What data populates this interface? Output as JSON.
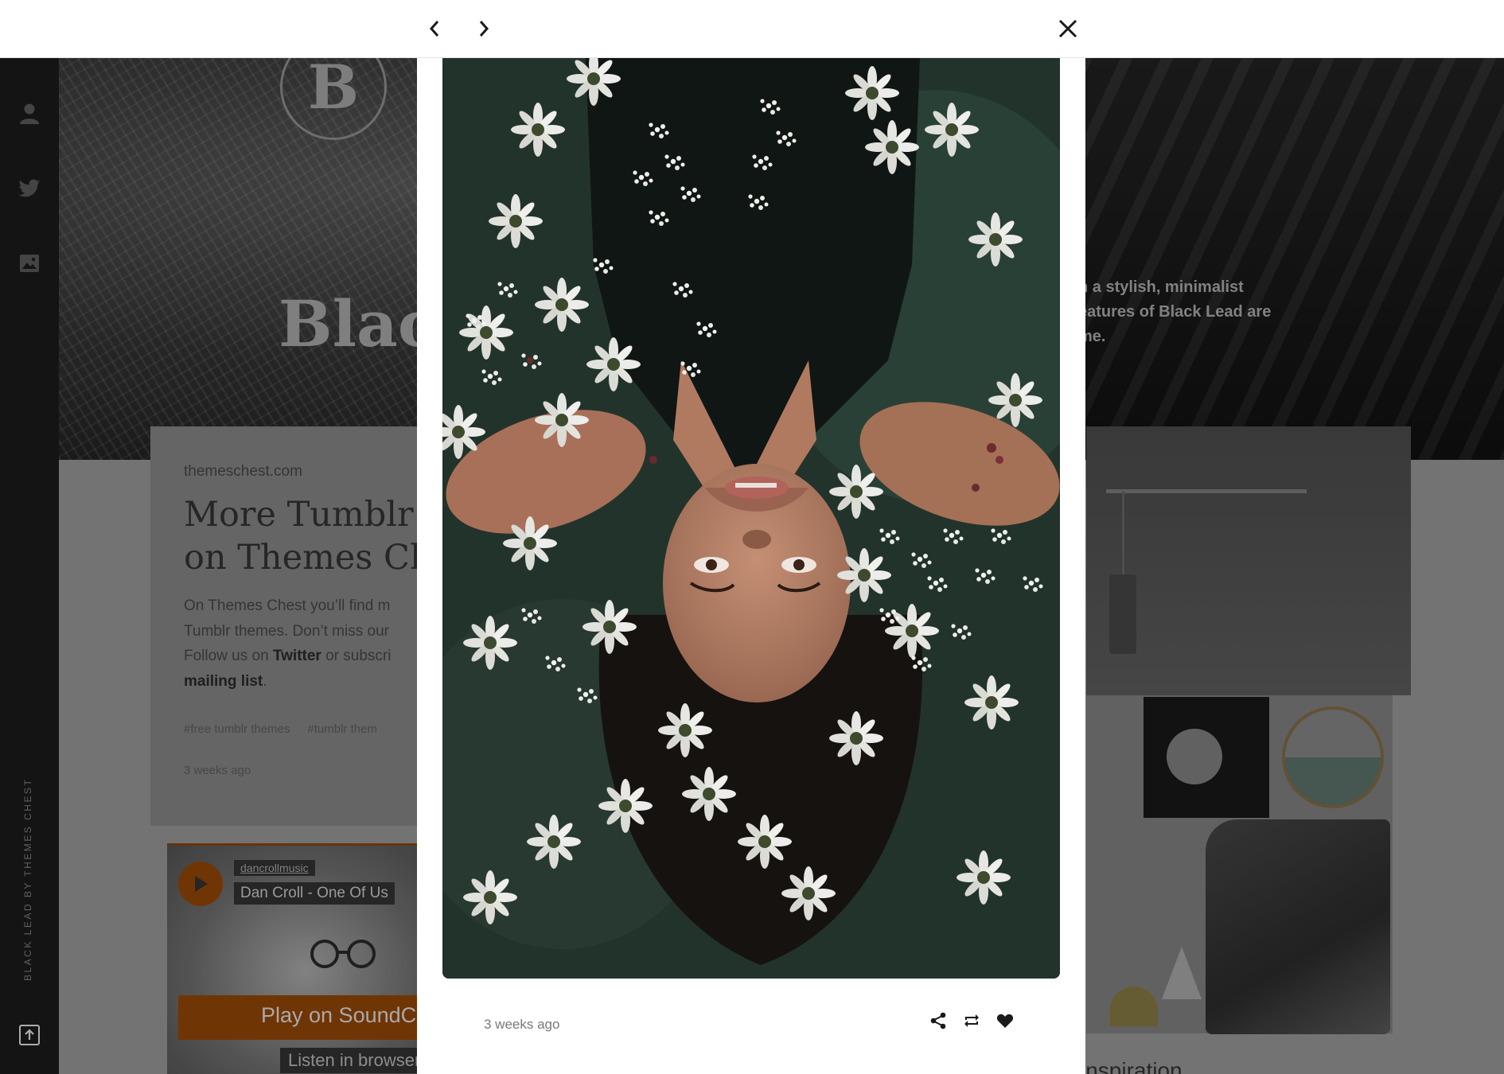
{
  "lightbox": {
    "prev_icon": "chevron-left-icon",
    "next_icon": "chevron-right-icon",
    "close_icon": "close-icon",
    "post_date": "3 weeks ago",
    "actions": [
      "share-icon",
      "reblog-icon",
      "heart-icon"
    ]
  },
  "background": {
    "logo_letter": "B",
    "blog_title": "Black",
    "description_lines": [
      "n a stylish, minimalist",
      "eatures of Black Lead are",
      "me."
    ],
    "sidebar_credit": "BLACK LEAD BY THEMES CHEST",
    "sidebar_icons": [
      "user-icon",
      "twitter-icon",
      "image-icon",
      "scroll-top-icon"
    ],
    "card": {
      "source": "themeschest.com",
      "title_lines": [
        "More Tumblr th",
        "on Themes Che"
      ],
      "body_line1": "On Themes Chest you’ll find m",
      "body_line2": "Tumblr themes. Don’t miss our",
      "body_line3_pre": "Follow us on ",
      "body_line3_link": "Twitter",
      "body_line3_post": " or subscri",
      "body_line4_link": "mailing list",
      "body_line4_post": ".",
      "tags": [
        "#free tumblr themes",
        "#tumblr them"
      ],
      "date": "3 weeks ago"
    },
    "soundcloud": {
      "user": "dancrollmusic",
      "track": "Dan Croll - One Of Us",
      "play_label": "Play on SoundCl",
      "listen_label": "Listen in browser"
    },
    "inspiration_partial": "inspiration"
  },
  "colors": {
    "modal_bg": "#ffffff",
    "topbar_bg": "#ffffff",
    "icon_color": "#1a1a1a",
    "photo_water": "#23342c"
  }
}
